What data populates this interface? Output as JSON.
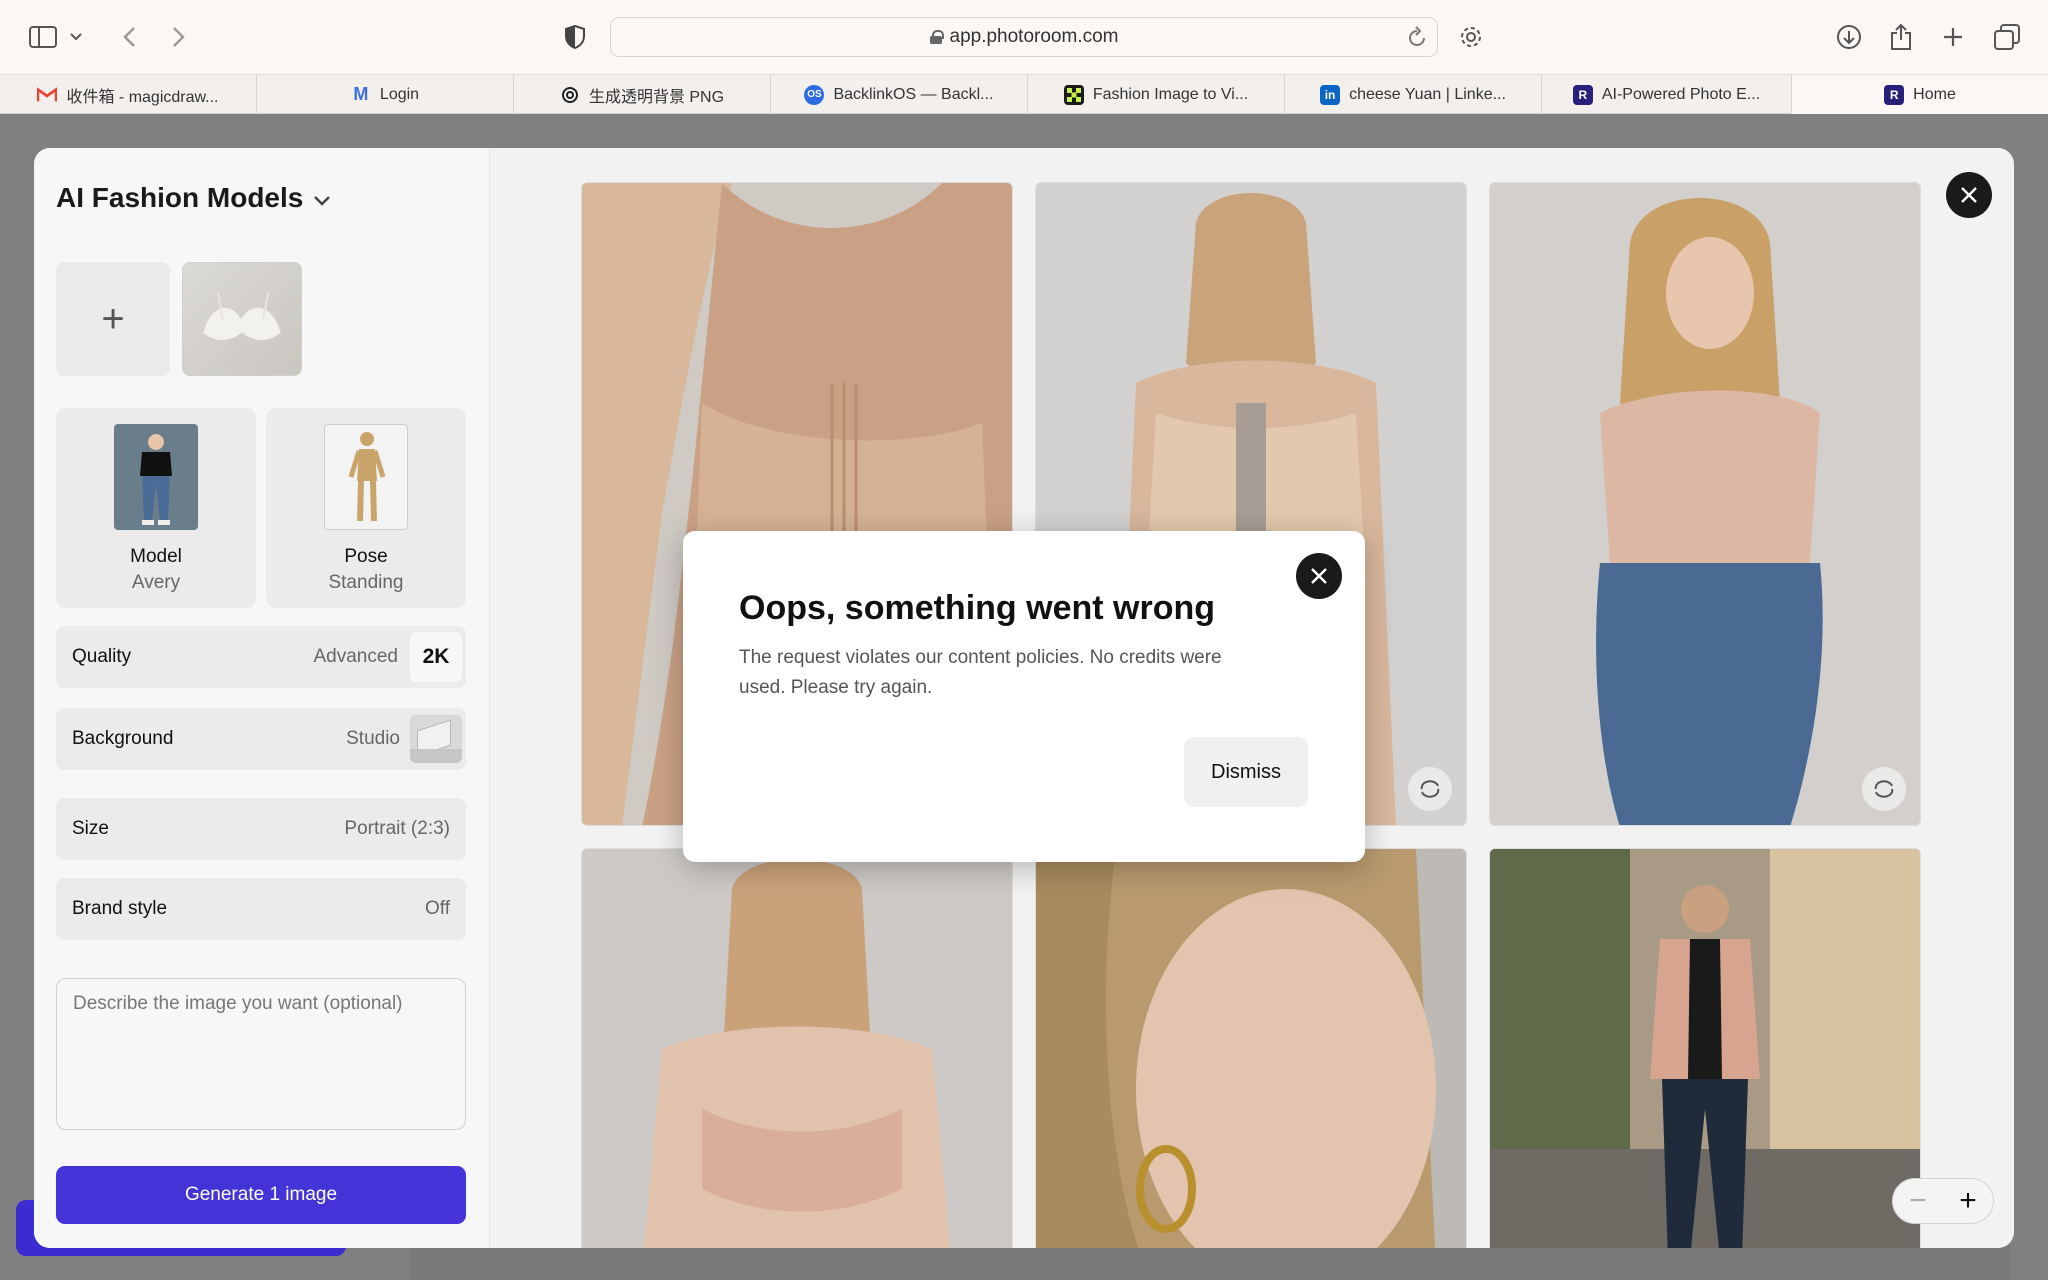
{
  "browser": {
    "url": "app.photoroom.com",
    "tabs": [
      {
        "label": "收件箱 - magicdraw...",
        "icon": "gmail-icon",
        "color": "#ea4335"
      },
      {
        "label": "Login",
        "icon": "m-logo-icon",
        "color": "#3b6fe0"
      },
      {
        "label": "生成透明背景 PNG",
        "icon": "openai-icon",
        "color": "#222222"
      },
      {
        "label": "BacklinkOS — Backl...",
        "icon": "os-logo-icon",
        "color": "#2d6be0"
      },
      {
        "label": "Fashion Image to Vi...",
        "icon": "grid-logo-icon",
        "color": "#1a1a1a"
      },
      {
        "label": "cheese Yuan | Linke...",
        "icon": "linkedin-icon",
        "color": "#0a66c2"
      },
      {
        "label": "AI-Powered Photo E...",
        "icon": "photoroom-icon",
        "color": "#2a1f7a"
      },
      {
        "label": "Home",
        "icon": "photoroom-icon",
        "color": "#2a1f7a"
      }
    ]
  },
  "panel": {
    "title": "AI Fashion Models",
    "add_symbol": "+",
    "model": {
      "label": "Model",
      "value": "Avery"
    },
    "pose": {
      "label": "Pose",
      "value": "Standing"
    },
    "quality": {
      "label": "Quality",
      "value": "Advanced",
      "badge": "2K"
    },
    "background": {
      "label": "Background",
      "value": "Studio"
    },
    "size": {
      "label": "Size",
      "value": "Portrait (2:3)"
    },
    "brand_style": {
      "label": "Brand style",
      "value": "Off"
    },
    "prompt_placeholder": "Describe the image you want (optional)",
    "generate_label": "Generate 1 image"
  },
  "dialog": {
    "title": "Oops, something went wrong",
    "message": "The request violates our content policies. No credits were used. Please try again.",
    "dismiss_label": "Dismiss"
  },
  "zoom": {
    "minus": "−",
    "plus": "+"
  },
  "colors": {
    "accent": "#4433d6",
    "dark": "#1a1a1a"
  }
}
